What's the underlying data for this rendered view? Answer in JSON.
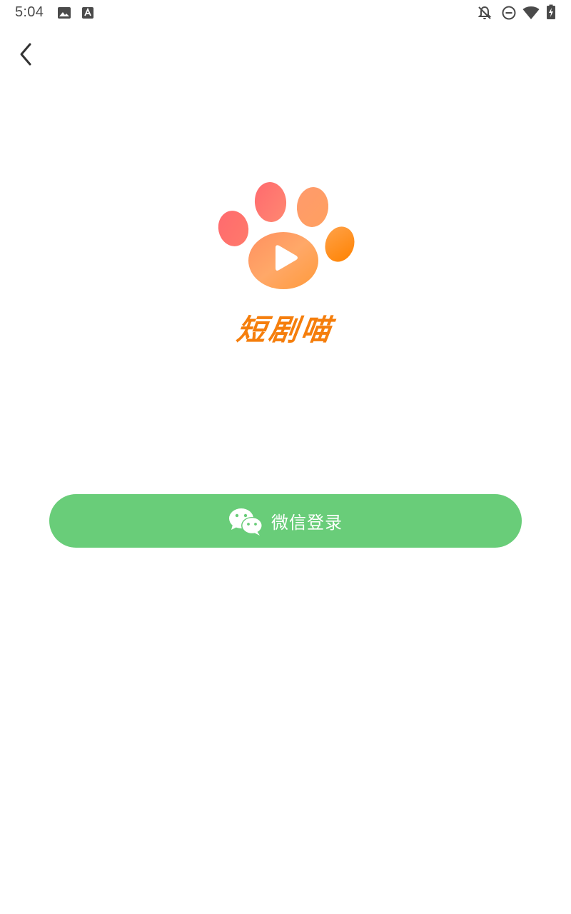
{
  "status_bar": {
    "time": "5:04",
    "icons": [
      "image-icon",
      "font-icon",
      "notifications-off-icon",
      "do-not-disturb-icon",
      "wifi-icon",
      "battery-charging-icon"
    ]
  },
  "nav": {
    "back_icon": "chevron-left-icon"
  },
  "brand": {
    "name": "短剧喵",
    "logo_icon": "paw-play-icon",
    "colors": {
      "text": "#f57e0c",
      "gradient_start": "#ff6a6f",
      "gradient_end": "#ff8a00"
    }
  },
  "login": {
    "wechat_label": "微信登录",
    "wechat_icon": "wechat-icon",
    "button_color": "#69cd79"
  }
}
